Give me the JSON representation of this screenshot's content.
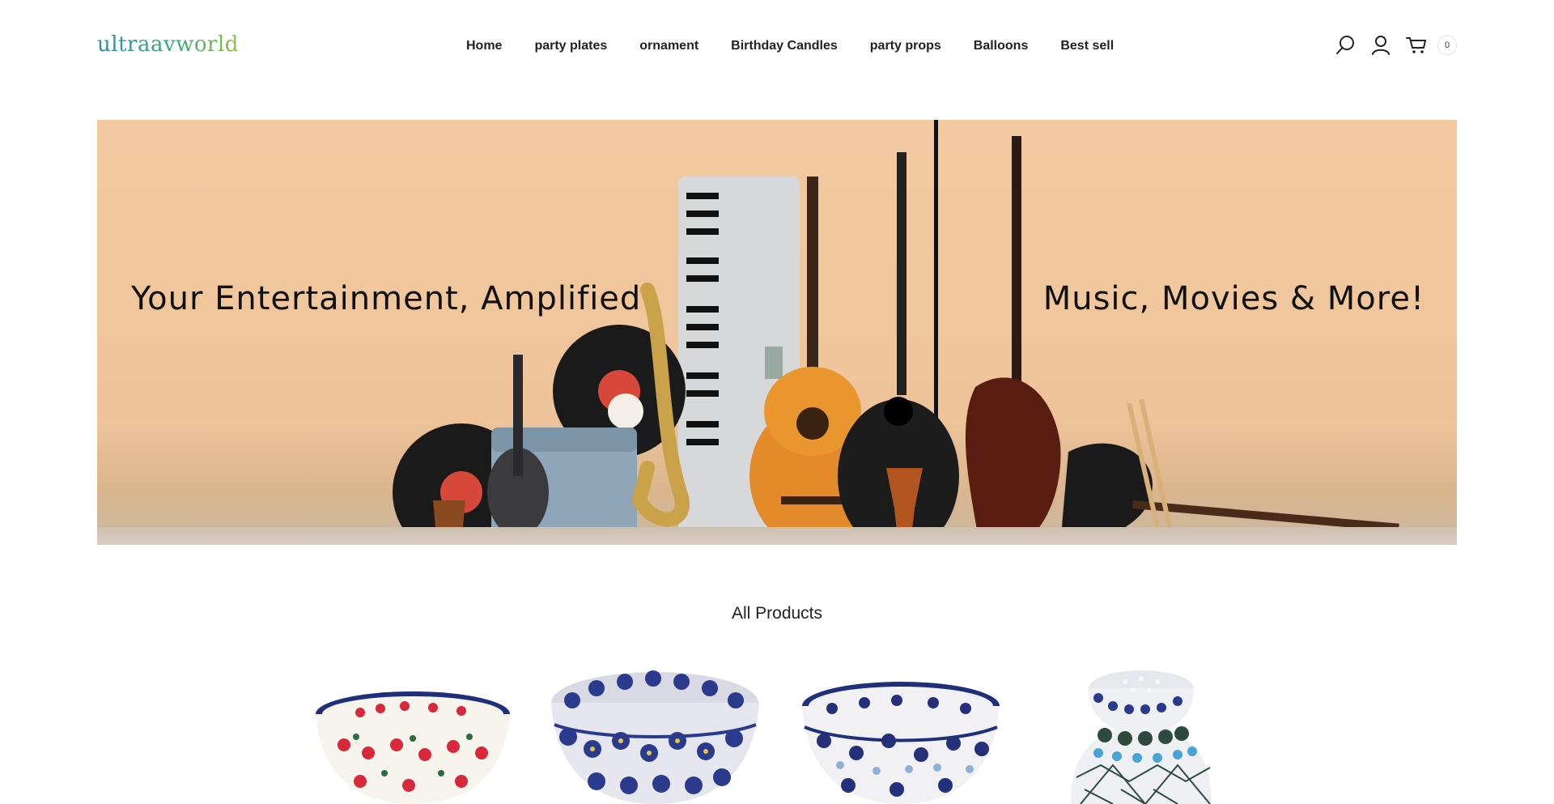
{
  "brand": {
    "logo_text": "ultraavworld"
  },
  "nav": {
    "items": [
      {
        "label": "Home"
      },
      {
        "label": "party plates"
      },
      {
        "label": "ornament"
      },
      {
        "label": "Birthday Candles"
      },
      {
        "label": "party props"
      },
      {
        "label": "Balloons"
      },
      {
        "label": "Best sell"
      }
    ]
  },
  "header_icons": {
    "search": "search-icon",
    "account": "user-icon",
    "cart": "cart-icon",
    "cart_count": "0"
  },
  "banner": {
    "left_text": "Your Entertainment, Amplified",
    "right_text": "Music, Movies & More!"
  },
  "section": {
    "title": "All Products"
  },
  "products": [
    {
      "name": "red-cherry-bowl"
    },
    {
      "name": "blue-floral-bowl"
    },
    {
      "name": "blue-flower-bowl"
    },
    {
      "name": "blue-vase-shaker"
    }
  ],
  "colors": {
    "banner_bg": "#efc49a",
    "logo_gradient_start": "#2a8fa8",
    "logo_gradient_end": "#8cc43e",
    "pottery_blue": "#1f2f7a",
    "cherry_red": "#d8283a"
  }
}
